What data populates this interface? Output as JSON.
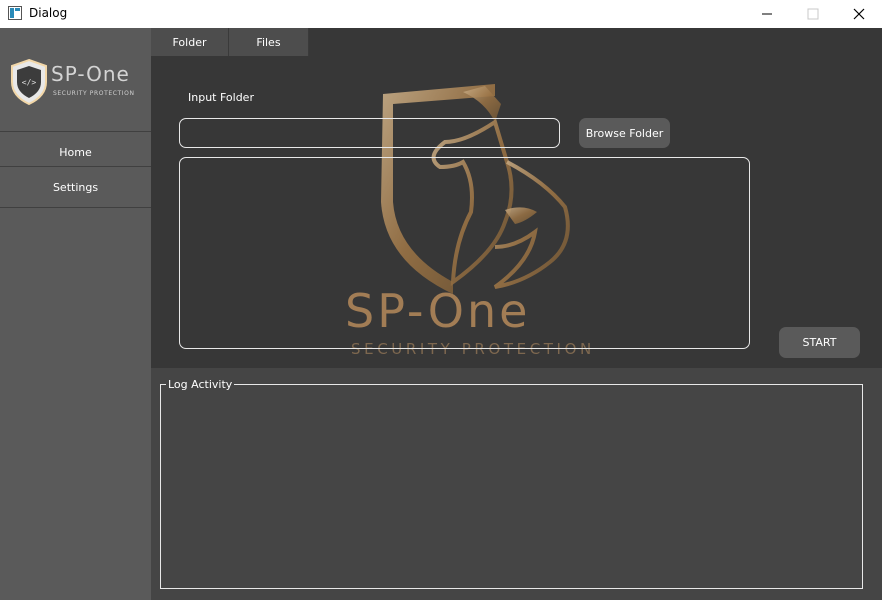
{
  "window": {
    "title": "Dialog"
  },
  "sidebar": {
    "logo_main": "SP-One",
    "logo_sub": "SECURITY PROTECTION",
    "items": [
      {
        "label": "Home"
      },
      {
        "label": "Settings"
      }
    ]
  },
  "tabs": [
    {
      "label": "Folder"
    },
    {
      "label": "Files"
    }
  ],
  "main": {
    "input_label": "Input Folder",
    "input_value": "",
    "browse_label": "Browse Folder",
    "start_label": "START",
    "watermark_main": "SP-One",
    "watermark_sub": "SECURITY PROTECTION"
  },
  "log": {
    "title": "Log Activity"
  },
  "colors": {
    "sidebar": "#5a5a5a",
    "content": "#373737",
    "log": "#454545",
    "accent": "#b58a5b"
  }
}
